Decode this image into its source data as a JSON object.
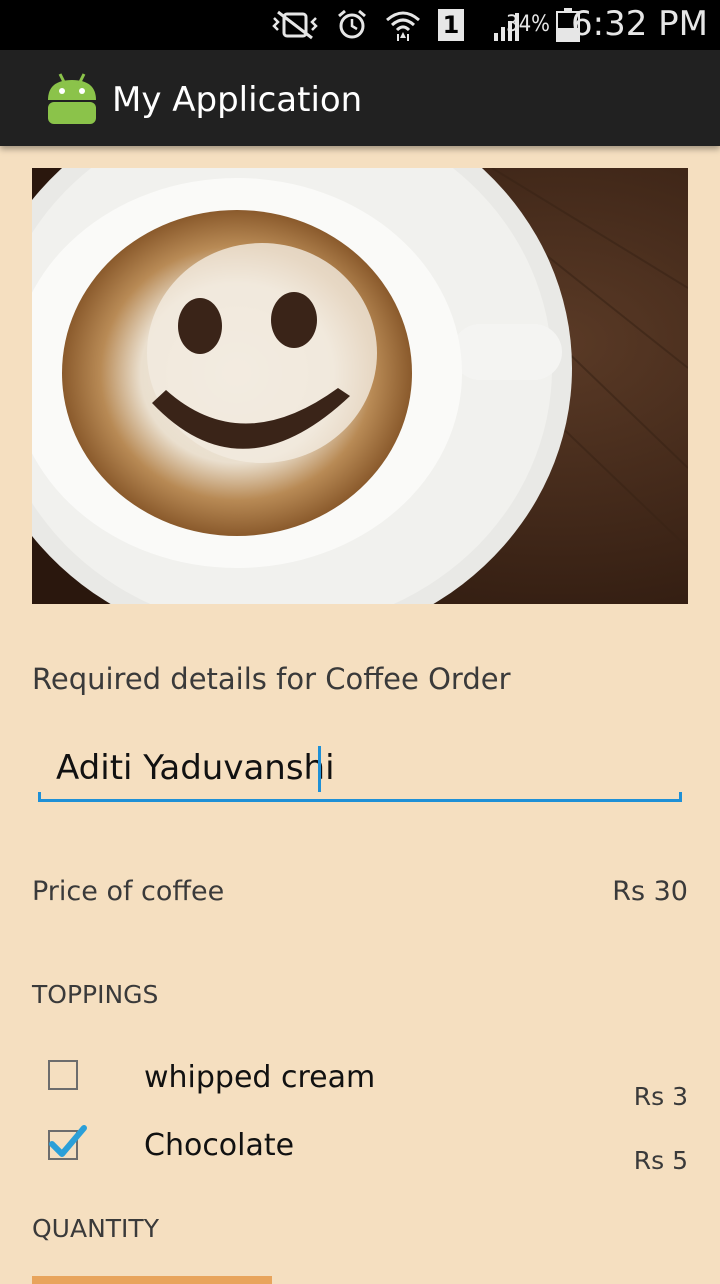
{
  "status_bar": {
    "battery_percent": "34%",
    "time": "6:32 PM",
    "sim_slot": "1"
  },
  "app_bar": {
    "title": "My Application"
  },
  "hero_image": {
    "alt": "coffee-smiley-latte"
  },
  "form": {
    "heading": "Required details for Coffee Order",
    "name_value": "Aditi Yaduvanshi",
    "price_label": "Price of coffee",
    "price_value": "Rs 30",
    "toppings_heading": "TOPPINGS",
    "toppings": [
      {
        "label": "whipped cream",
        "price": "Rs 3",
        "checked": false
      },
      {
        "label": "Chocolate",
        "price": "Rs 5",
        "checked": true
      }
    ],
    "quantity_heading": "QUANTITY"
  },
  "colors": {
    "background": "#f5dfc0",
    "action_bar": "#212121",
    "accent": "#1e90d6",
    "android_green": "#8bc34a",
    "quantity_control": "#e8a45c"
  }
}
